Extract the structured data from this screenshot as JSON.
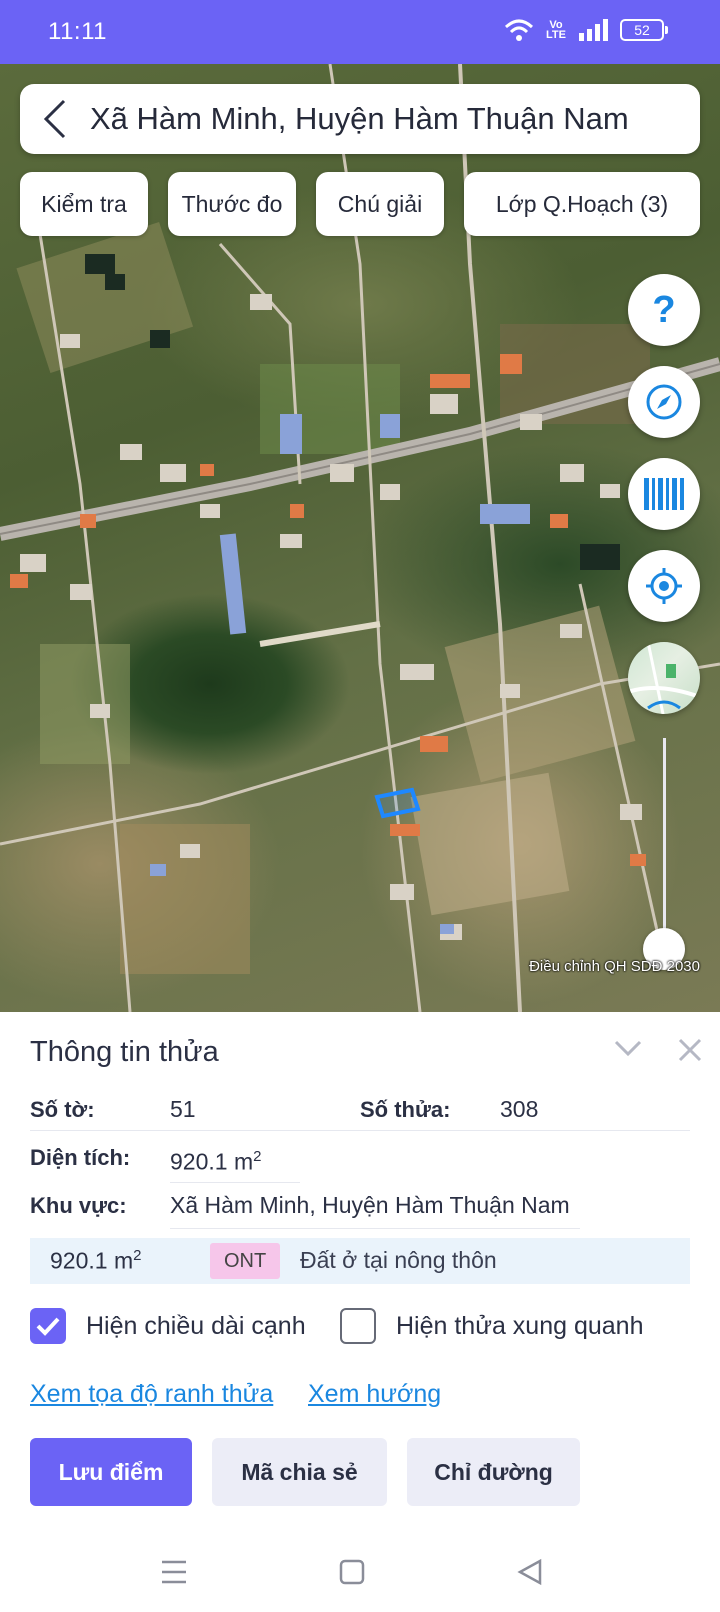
{
  "status_bar": {
    "time": "11:11",
    "volte_top": "Vo",
    "volte_bottom": "LTE",
    "battery": "52"
  },
  "search": {
    "text": "Xã Hàm Minh, Huyện Hàm Thuận Nam"
  },
  "chips": [
    {
      "label": "Kiểm tra"
    },
    {
      "label": "Thước đo"
    },
    {
      "label": "Chú giải"
    },
    {
      "label": "Lớp Q.Hoạch (3)"
    }
  ],
  "map": {
    "layer_caption": "Điều chỉnh QH SDĐ 2030",
    "parcel_color": "#1e88ff"
  },
  "parcel_info": {
    "title": "Thông tin thửa",
    "sheet_label": "Số tờ:",
    "sheet_value": "51",
    "parcel_label": "Số thửa:",
    "parcel_value": "308",
    "area_label": "Diện tích:",
    "area_value": "920.1 m",
    "area_unit_sup": "2",
    "region_label": "Khu vực:",
    "region_value": "Xã Hàm Minh, Huyện Hàm Thuận Nam",
    "landuse": {
      "area": "920.1 m",
      "area_sup": "2",
      "code": "ONT",
      "name": "Đất ở tại nông thôn"
    }
  },
  "options": {
    "show_edge_length": {
      "label": "Hiện chiều dài cạnh",
      "checked": true
    },
    "show_neighbors": {
      "label": "Hiện thửa xung quanh",
      "checked": false
    }
  },
  "links": {
    "coords": "Xem tọa độ ranh thửa",
    "direction": "Xem hướng"
  },
  "buttons": {
    "save": "Lưu điểm",
    "share": "Mã chia sẻ",
    "directions": "Chỉ đường"
  },
  "colors": {
    "accent": "#6b63f5",
    "link": "#1a87e0",
    "landuse_code_bg": "#f6c6ea",
    "landuse_row_bg": "#eaf3fb"
  }
}
